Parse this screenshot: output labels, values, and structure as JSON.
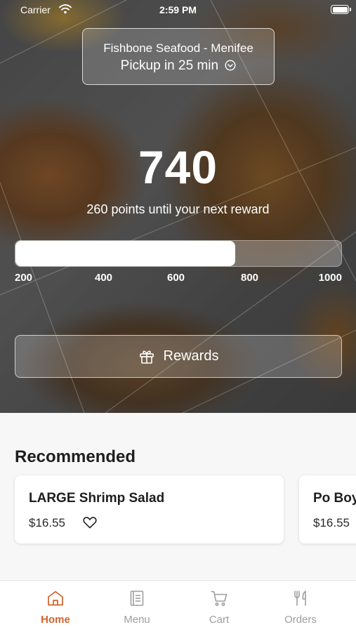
{
  "status_bar": {
    "carrier": "Carrier",
    "time": "2:59 PM",
    "icons": [
      "wifi-icon",
      "battery-icon"
    ]
  },
  "location": {
    "store_name": "Fishbone Seafood - Menifee",
    "pickup_text": "Pickup in 25 min",
    "icon": "chevron-down-circle-icon"
  },
  "points": {
    "value": "740",
    "caption": "260 points until your next reward",
    "progress": {
      "min": 200,
      "max": 1000,
      "current": 740,
      "ticks": [
        "200",
        "400",
        "600",
        "800",
        "1000"
      ]
    }
  },
  "rewards_button": {
    "label": "Rewards",
    "icon": "gift-icon"
  },
  "recommended": {
    "title": "Recommended",
    "items": [
      {
        "name": "LARGE Shrimp Salad",
        "price": "$16.55",
        "icon": "heart-icon"
      },
      {
        "name": "Po Boy",
        "price": "$16.55"
      }
    ]
  },
  "tab_bar": {
    "active_color": "#d2622a",
    "inactive_color": "#9e9e9e",
    "tabs": [
      {
        "label": "Home",
        "icon": "home-icon",
        "active": true
      },
      {
        "label": "Menu",
        "icon": "menu-book-icon",
        "active": false
      },
      {
        "label": "Cart",
        "icon": "cart-icon",
        "active": false
      },
      {
        "label": "Orders",
        "icon": "utensils-icon",
        "active": false
      }
    ]
  }
}
